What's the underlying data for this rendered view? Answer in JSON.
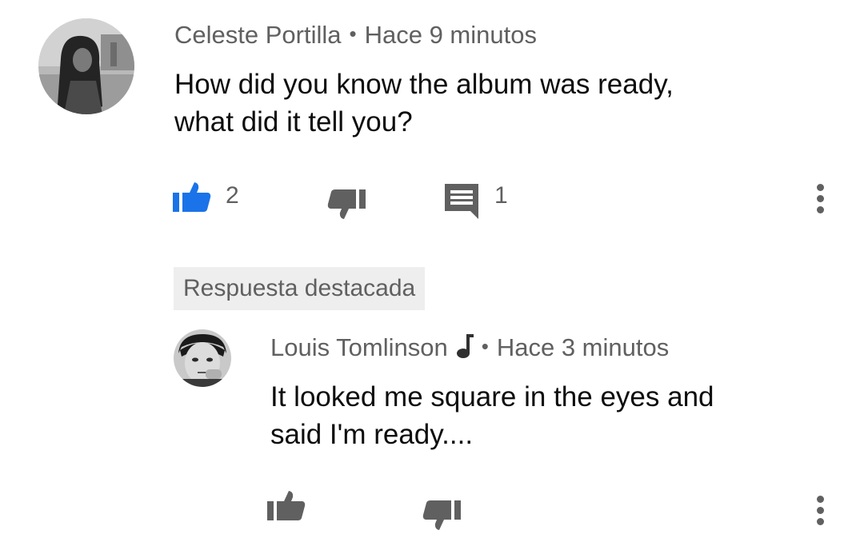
{
  "comment": {
    "author": "Celeste Portilla",
    "time": "Hace 9 minutos",
    "text_line1": "How did you know the album was ready,",
    "text_line2": "what did it tell you?",
    "likes": "2",
    "replies": "1",
    "liked": true
  },
  "pinned_label": "Respuesta destacada",
  "reply": {
    "author": "Louis Tomlinson",
    "author_badge_icon": "music-note-icon",
    "time": "Hace 3 minutos",
    "text_line1": "It looked me square in the eyes and",
    "text_line2": "said I'm ready...."
  },
  "colors": {
    "like_active": "#1a73e8",
    "icon_gray": "#606060",
    "meta_gray": "#606060",
    "text": "#0d0d0d",
    "chip_bg": "#eeeeee"
  }
}
